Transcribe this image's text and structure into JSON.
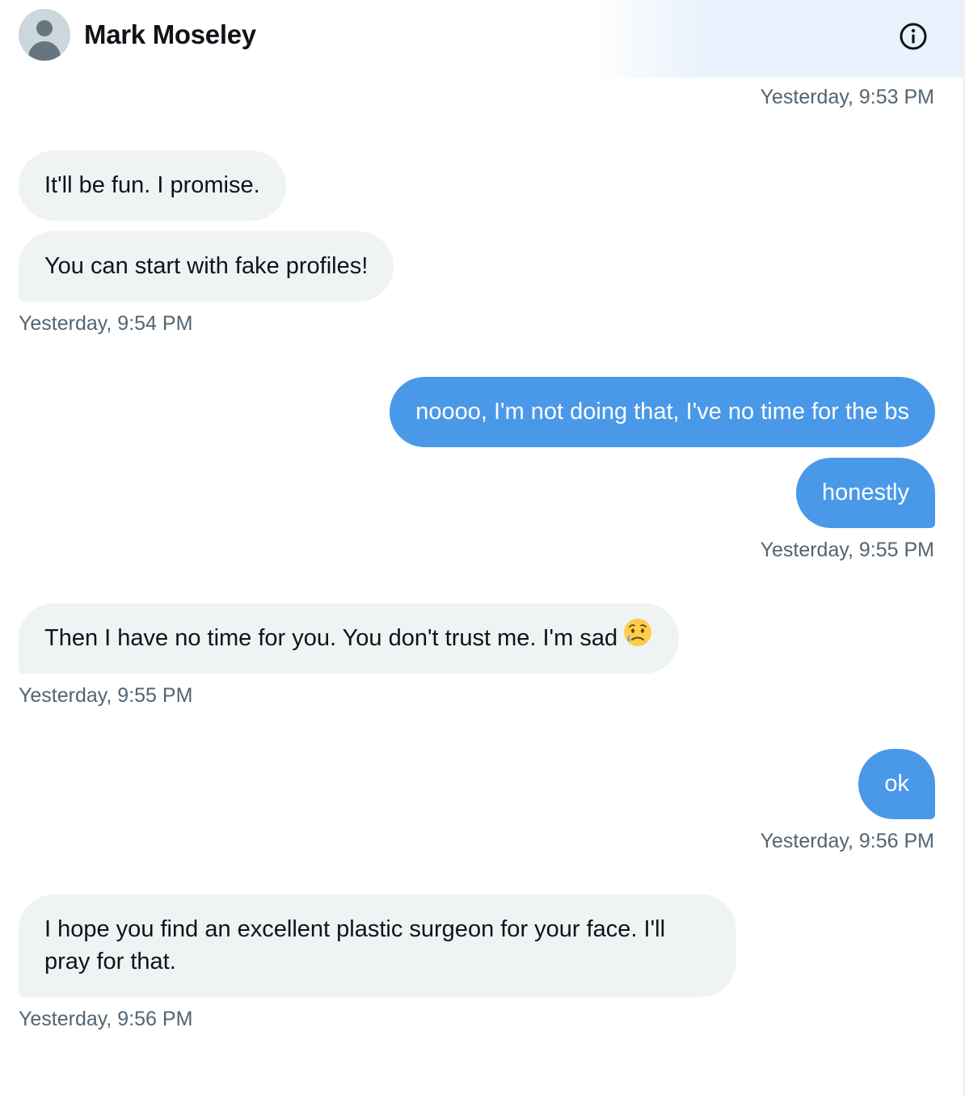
{
  "conversation": {
    "contact_name": "Mark Moseley",
    "avatar_icon": "default-avatar-icon",
    "info_icon": "info-icon"
  },
  "colors": {
    "outgoing_bubble": "#4a99e9",
    "incoming_bubble": "#eff3f4",
    "timestamp_text": "#536471",
    "header_highlight": "#e9f2fc"
  },
  "messages": [
    {
      "direction": "outgoing",
      "timestamp": "Yesterday, 9:53 PM"
    },
    {
      "direction": "incoming",
      "text": "It'll be fun. I promise."
    },
    {
      "direction": "incoming",
      "text": "You can start with fake profiles!",
      "timestamp": "Yesterday, 9:54 PM"
    },
    {
      "direction": "outgoing",
      "text": "noooo, I'm not doing that, I've no time for the bs"
    },
    {
      "direction": "outgoing",
      "text": "honestly",
      "timestamp": "Yesterday, 9:55 PM"
    },
    {
      "direction": "incoming",
      "text": "Then I have no time for you. You don't trust me. I'm sad",
      "emoji": "sad-but-relieved-face-icon",
      "timestamp": "Yesterday, 9:55 PM"
    },
    {
      "direction": "outgoing",
      "text": "ok",
      "timestamp": "Yesterday, 9:56 PM"
    },
    {
      "direction": "incoming",
      "text": "I hope you find an excellent plastic surgeon for your face. I'll pray for that.",
      "timestamp": "Yesterday, 9:56 PM"
    }
  ]
}
